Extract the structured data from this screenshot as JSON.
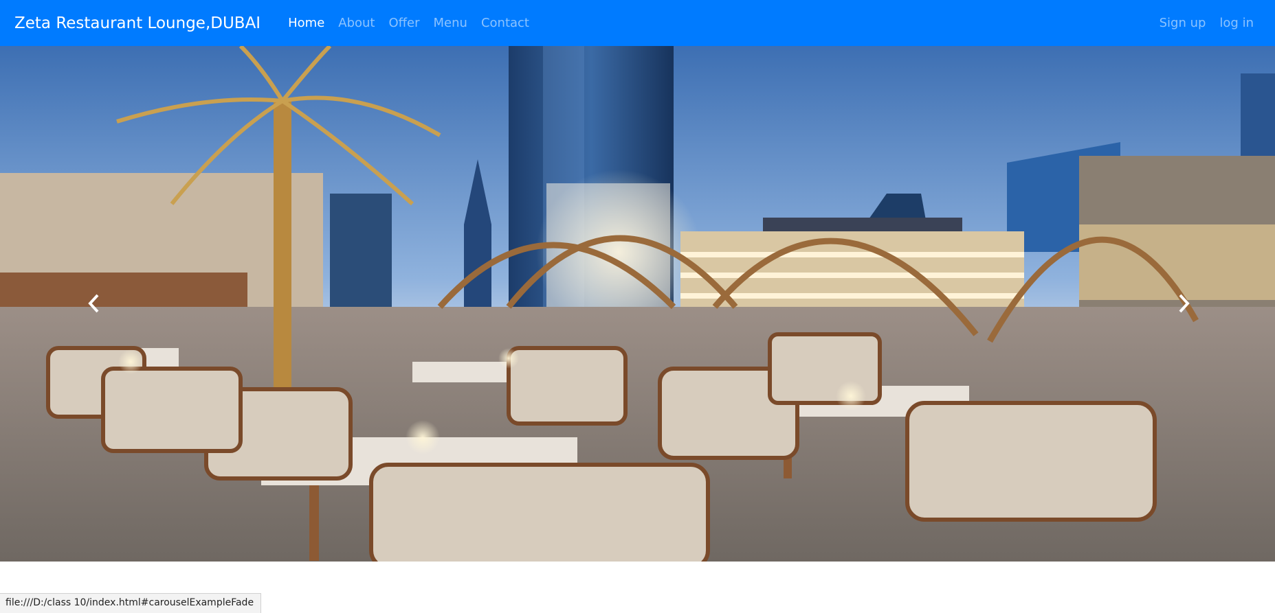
{
  "navbar": {
    "brand": "Zeta Restaurant Lounge,DUBAI",
    "links": [
      "Home",
      "About",
      "Offer",
      "Menu",
      "Contact"
    ],
    "active": "Home",
    "right_links": [
      "Sign up",
      "log in"
    ],
    "bg_color": "#007bff"
  },
  "carousel": {
    "image_description_icon": "restaurant-terrace-photo",
    "prev_icon": "chevron-left-icon",
    "next_icon": "chevron-right-icon"
  },
  "statusbar": {
    "url": "file:///D:/class 10/index.html#carouselExampleFade"
  }
}
